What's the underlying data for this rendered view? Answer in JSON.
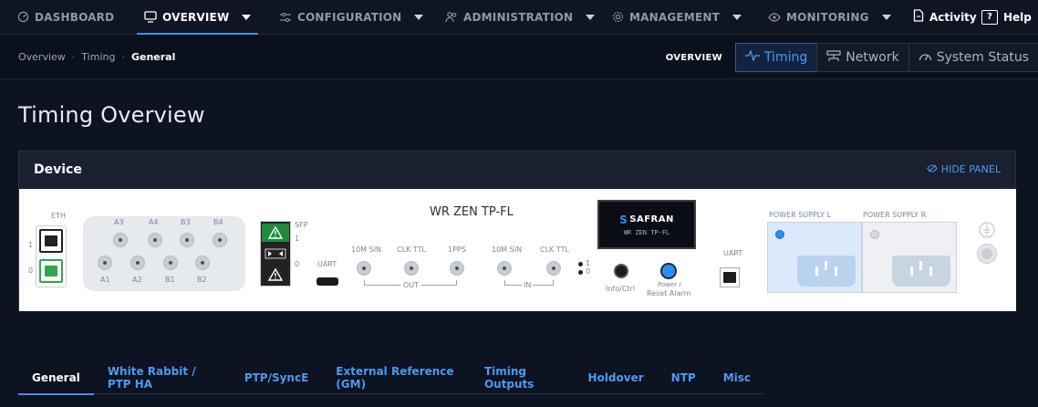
{
  "topnav": {
    "items": [
      {
        "label": "DASHBOARD",
        "icon": "dashboard-gauge-icon"
      },
      {
        "label": "OVERVIEW",
        "icon": "monitor-icon"
      },
      {
        "label": "CONFIGURATION",
        "icon": "sliders-icon"
      },
      {
        "label": "ADMINISTRATION",
        "icon": "users-icon"
      },
      {
        "label": "MANAGEMENT",
        "icon": "gear-icon"
      },
      {
        "label": "MONITORING",
        "icon": "eye-icon"
      }
    ],
    "activity_label": "Activity",
    "help_label": "Help",
    "help_glyph": "?"
  },
  "breadcrumb": {
    "items": [
      "Overview",
      "Timing",
      "General"
    ],
    "separator": "·"
  },
  "subnav": {
    "label": "OVERVIEW",
    "tabs": [
      {
        "label": "Timing",
        "icon": "pulse-icon"
      },
      {
        "label": "Network",
        "icon": "network-icon"
      },
      {
        "label": "System Status",
        "icon": "gauge-icon"
      }
    ]
  },
  "page": {
    "title": "Timing Overview"
  },
  "panel": {
    "title": "Device",
    "hide_label": "HIDE PANEL"
  },
  "device": {
    "model": "WR ZEN TP-FL",
    "eth_label": "ETH",
    "eth_ports": [
      "1",
      "0"
    ],
    "top_ports": [
      "A3",
      "A4",
      "B3",
      "B4"
    ],
    "bottom_ports": [
      "A1",
      "A2",
      "B1",
      "B2"
    ],
    "sfp_label": "SFP",
    "sfp_ports": [
      "1",
      "0"
    ],
    "uart_label": "UART",
    "out_ports": [
      "10M SIN",
      "CLK TTL",
      "1PPS"
    ],
    "out_label": "OUT",
    "in_ports": [
      "10M SIN",
      "CLK TTL"
    ],
    "in_label": "IN",
    "led_labels": [
      "1",
      "0"
    ],
    "display_brand": "SAFRAN",
    "display_model": "WR ZEN TP-FL",
    "info_ctrl_label": "Info/Ctrl",
    "power_reset_label_1": "Power /",
    "power_reset_label_2": "Reset Alarm",
    "uart2_label": "UART",
    "psu_left": "POWER SUPPLY L",
    "psu_right": "POWER SUPPLY R",
    "colors": {
      "eth_active": "#2ea84a",
      "warning": "#1e8a3c",
      "led_active": "#2f8cf0"
    }
  },
  "bottom_tabs": [
    "General",
    "White Rabbit / PTP HA",
    "PTP/SyncE",
    "External Reference (GM)",
    "Timing Outputs",
    "Holdover",
    "NTP",
    "Misc"
  ]
}
